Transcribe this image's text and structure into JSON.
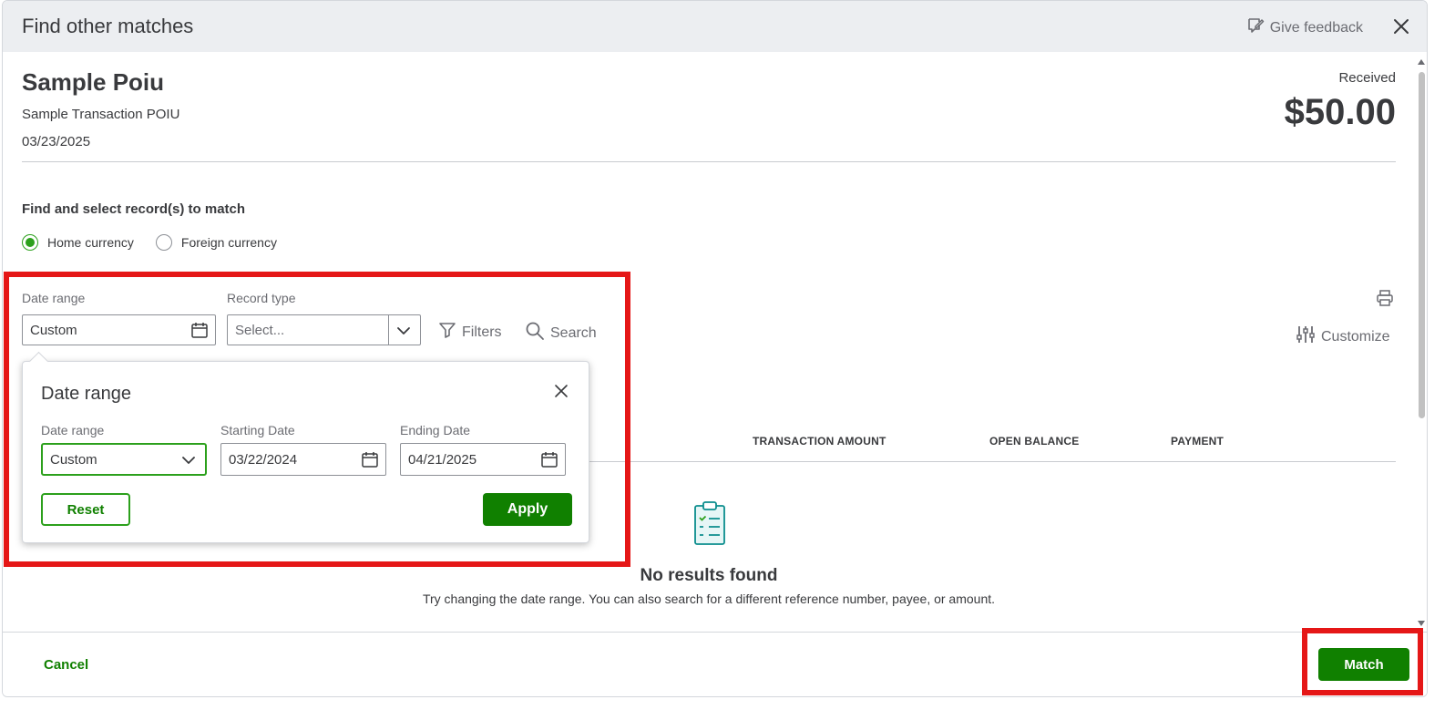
{
  "header": {
    "title": "Find other matches",
    "feedback_label": "Give feedback"
  },
  "transaction": {
    "payee": "Sample Poiu",
    "description": "Sample Transaction POIU",
    "date": "03/23/2025",
    "direction_label": "Received",
    "amount": "$50.00"
  },
  "find": {
    "title": "Find and select record(s) to match",
    "currency_options": [
      {
        "label": "Home currency",
        "selected": true
      },
      {
        "label": "Foreign currency",
        "selected": false
      }
    ]
  },
  "filters": {
    "date_range_label": "Date range",
    "date_range_value": "Custom",
    "record_type_label": "Record type",
    "record_type_placeholder": "Select...",
    "filters_label": "Filters",
    "search_label": "Search",
    "customize_label": "Customize"
  },
  "table": {
    "columns": [
      "TRANSACTION AMOUNT",
      "OPEN BALANCE",
      "PAYMENT"
    ],
    "empty_title": "No results found",
    "empty_description": "Try changing the date range. You can also search for a different reference number, payee, or amount."
  },
  "popover": {
    "title": "Date range",
    "range_label": "Date range",
    "range_value": "Custom",
    "start_label": "Starting Date",
    "start_value": "03/22/2024",
    "end_label": "Ending Date",
    "end_value": "04/21/2025",
    "reset_label": "Reset",
    "apply_label": "Apply"
  },
  "footer": {
    "cancel_label": "Cancel",
    "match_label": "Match"
  },
  "colors": {
    "accent_green": "#108000",
    "radio_green": "#2ca01c",
    "highlight_red": "#e51717"
  }
}
